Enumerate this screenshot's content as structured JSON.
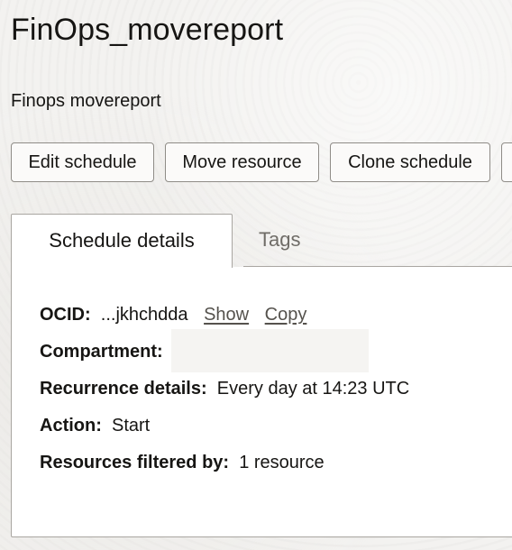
{
  "header": {
    "title": "FinOps_movereport",
    "description": "Finops movereport"
  },
  "toolbar": {
    "edit_label": "Edit schedule",
    "move_label": "Move resource",
    "clone_label": "Clone schedule"
  },
  "tabs": [
    {
      "label": "Schedule details",
      "active": true
    },
    {
      "label": "Tags",
      "active": false
    }
  ],
  "details": {
    "ocid_label": "OCID:",
    "ocid_value": "...jkhchdda",
    "ocid_show": "Show",
    "ocid_copy": "Copy",
    "compartment_label": "Compartment:",
    "recurrence_label": "Recurrence details:",
    "recurrence_value": "Every day at 14:23 UTC",
    "action_label": "Action:",
    "action_value": "Start",
    "resources_label": "Resources filtered by:",
    "resources_value": "1 resource"
  },
  "colors": {
    "text": "#161513",
    "link": "#55524d",
    "border": "#a9a6a1",
    "panel": "#ffffff",
    "page_background": "#f3f2f0"
  }
}
